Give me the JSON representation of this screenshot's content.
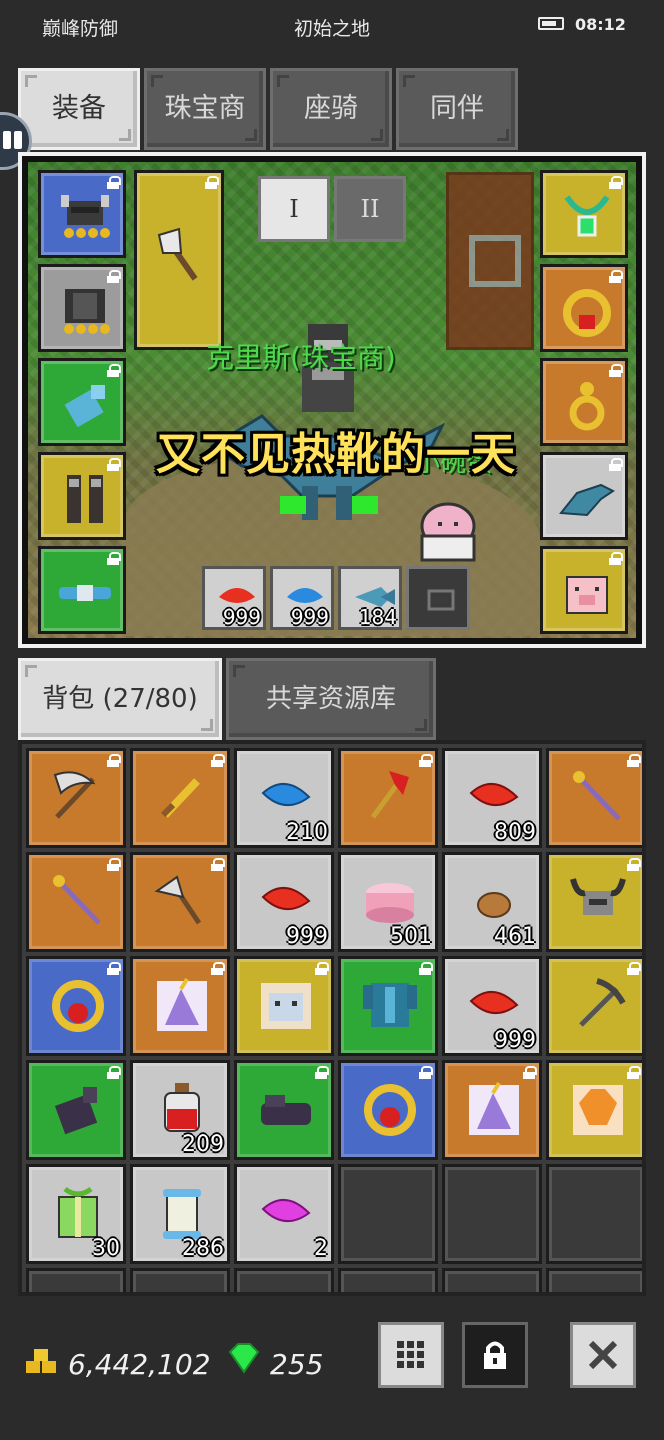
{
  "status_bar": {
    "left_text": "巅峰防御",
    "center_text": "初始之地",
    "time": "08:12"
  },
  "top_tabs": [
    {
      "label": "装备",
      "active": true
    },
    {
      "label": "珠宝商",
      "active": false
    },
    {
      "label": "座骑",
      "active": false
    },
    {
      "label": "同伴",
      "active": false
    }
  ],
  "scene": {
    "roman_tabs": [
      "I",
      "II"
    ],
    "npc_name": "克里斯(珠宝商)",
    "pet_name": "小碗蛋",
    "caption": "又不见热靴的一天",
    "left_slots": [
      {
        "icon": "horned-helmet-icon",
        "color": "blue"
      },
      {
        "icon": "chest-armor-icon",
        "color": "gray"
      },
      {
        "icon": "gauntlet-icon",
        "color": "green"
      },
      {
        "icon": "leg-armor-icon",
        "color": "gold"
      },
      {
        "icon": "belt-icon",
        "color": "green"
      }
    ],
    "weapon_slot": {
      "icon": "battle-axe-icon",
      "color": "gold"
    },
    "right_slots": [
      {
        "icon": "emerald-necklace-icon",
        "color": "gold"
      },
      {
        "icon": "ruby-ring-icon",
        "color": "orange"
      },
      {
        "icon": "gold-earring-icon",
        "color": "orange"
      },
      {
        "icon": "dino-mount-icon",
        "color": "light"
      },
      {
        "icon": "pig-pet-icon",
        "color": "gold"
      }
    ],
    "consumables": [
      {
        "icon": "red-feather-icon",
        "count": "999"
      },
      {
        "icon": "blue-feather-icon",
        "count": "999"
      },
      {
        "icon": "fish-icon",
        "count": "184"
      },
      {
        "icon": "pet-slot-icon",
        "count": ""
      }
    ]
  },
  "bag_tabs": [
    {
      "label": "背包 (27/80)",
      "active": true
    },
    {
      "label": "共享资源库",
      "active": false
    }
  ],
  "bag_items": [
    {
      "icon": "scythe-icon",
      "color": "orange",
      "count": ""
    },
    {
      "icon": "gold-sword-icon",
      "color": "orange",
      "count": ""
    },
    {
      "icon": "blue-feather-icon",
      "color": "light",
      "count": "210"
    },
    {
      "icon": "red-trident-icon",
      "color": "orange",
      "count": ""
    },
    {
      "icon": "red-feather-icon",
      "color": "light",
      "count": "809"
    },
    {
      "icon": "staff-icon",
      "color": "orange",
      "count": ""
    },
    {
      "icon": "staff-icon",
      "color": "orange",
      "count": ""
    },
    {
      "icon": "axe-icon",
      "color": "orange",
      "count": ""
    },
    {
      "icon": "red-feather-icon",
      "color": "light",
      "count": "999"
    },
    {
      "icon": "cake-icon",
      "color": "light",
      "count": "501"
    },
    {
      "icon": "ore-icon",
      "color": "light",
      "count": "461"
    },
    {
      "icon": "horned-helmet-icon",
      "color": "gold",
      "count": ""
    },
    {
      "icon": "ruby-ring-icon",
      "color": "blue",
      "count": ""
    },
    {
      "icon": "unicorn-card-icon",
      "color": "orange",
      "count": ""
    },
    {
      "icon": "cat-card-icon",
      "color": "gold",
      "count": ""
    },
    {
      "icon": "blue-armor-icon",
      "color": "green",
      "count": ""
    },
    {
      "icon": "red-feather-icon",
      "color": "light",
      "count": "999"
    },
    {
      "icon": "pickaxe-icon",
      "color": "gold",
      "count": ""
    },
    {
      "icon": "dark-glove-icon",
      "color": "green",
      "count": ""
    },
    {
      "icon": "potion-icon",
      "color": "light",
      "count": "209"
    },
    {
      "icon": "dark-boots-icon",
      "color": "green",
      "count": ""
    },
    {
      "icon": "ruby-ring-icon",
      "color": "blue",
      "count": ""
    },
    {
      "icon": "unicorn-card-icon",
      "color": "orange",
      "count": ""
    },
    {
      "icon": "fox-card-icon",
      "color": "gold",
      "count": ""
    },
    {
      "icon": "green-gift-icon",
      "color": "light",
      "count": "30"
    },
    {
      "icon": "scroll-icon",
      "color": "light",
      "count": "286"
    },
    {
      "icon": "pink-feather-icon",
      "color": "light",
      "count": "2"
    }
  ],
  "currency": {
    "gold": "6,442,102",
    "gems": "255"
  },
  "colors": {
    "blue": "#4a6ac8",
    "gray": "#9c9c9c",
    "green": "#2ea836",
    "gold": "#c8b22c",
    "orange": "#c87a2c",
    "light": "#c8c8c8"
  }
}
